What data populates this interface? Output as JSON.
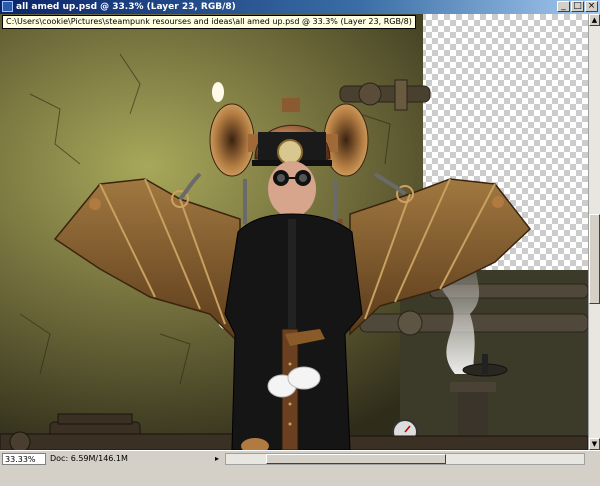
{
  "window": {
    "title": "all amed up.psd @ 33.3% (Layer 23, RGB/8)",
    "path_tooltip": "C:\\Users\\cookie\\Pictures\\steampunk resourses and ideas\\all amed up.psd @ 33.3% (Layer 23, RGB/8)",
    "minimize_glyph": "_",
    "maximize_glyph": "□",
    "close_glyph": "×"
  },
  "statusbar": {
    "zoom": "33.33%",
    "doc_info": "Doc: 6.59M/146.1M",
    "arrow_glyph": "▸"
  },
  "scrollbar": {
    "up_glyph": "▲",
    "down_glyph": "▼"
  },
  "colors": {
    "title_start": "#0a246a",
    "title_end": "#a6caf0",
    "wall": "#6e6a3a",
    "wing": "#8a6a3a",
    "suit": "#151515",
    "brass": "#b07a40"
  }
}
